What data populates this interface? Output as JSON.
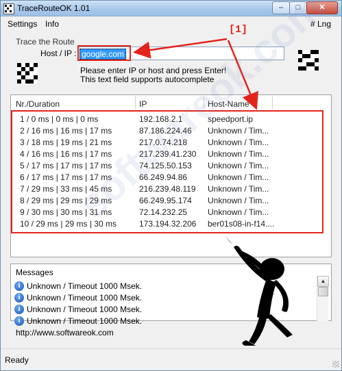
{
  "window": {
    "title": "TraceRouteOK 1.01",
    "min_glyph": "–",
    "max_glyph": "□",
    "close_glyph": "✕"
  },
  "menu": {
    "items": [
      "Settings",
      "Info"
    ],
    "lang": "# Lng"
  },
  "annotation": {
    "label": "[1]"
  },
  "trace": {
    "group_label": "Trace the Route",
    "host_label": "Host / IP :",
    "host_value": "google.com",
    "hint1": "Please enter IP or host and press Enter!",
    "hint2": "This text field supports autocomplete"
  },
  "table": {
    "columns": [
      "Nr./Duration",
      "IP",
      "Host-Name"
    ],
    "rows": [
      {
        "nr": "1 / 0 ms | 0 ms | 0 ms",
        "ip": "192.168.2.1",
        "host": "speedport.ip"
      },
      {
        "nr": "2 / 16 ms | 16 ms | 17 ms",
        "ip": "87.186.224.46",
        "host": "Unknown / Tim..."
      },
      {
        "nr": "3 / 18 ms | 19 ms | 21 ms",
        "ip": "217.0.74.218",
        "host": "Unknown / Tim..."
      },
      {
        "nr": "4 / 16 ms | 16 ms | 17 ms",
        "ip": "217.239.41.230",
        "host": "Unknown / Tim..."
      },
      {
        "nr": "5 / 17 ms | 17 ms | 17 ms",
        "ip": "74.125.50.153",
        "host": "Unknown / Tim..."
      },
      {
        "nr": "6 / 17 ms | 17 ms | 17 ms",
        "ip": "66.249.94.86",
        "host": "Unknown / Tim..."
      },
      {
        "nr": "7 / 29 ms | 33 ms | 45 ms",
        "ip": "216.239.48.119",
        "host": "Unknown / Tim..."
      },
      {
        "nr": "8 / 29 ms | 29 ms | 29 ms",
        "ip": "66.249.95.174",
        "host": "Unknown / Tim..."
      },
      {
        "nr": "9 / 30 ms | 30 ms | 31 ms",
        "ip": "72.14.232.25",
        "host": "Unknown / Tim..."
      },
      {
        "nr": "10 / 29 ms | 29 ms | 30 ms",
        "ip": "173.194.32.206",
        "host": "ber01s08-in-f14...."
      }
    ]
  },
  "messages": {
    "header": "Messages",
    "items": [
      "Unknown / Timeout 1000 Msek.",
      "Unknown / Timeout 1000 Msek.",
      "Unknown / Timeout 1000 Msek.",
      "Unknown / Timeout 1000 Msek."
    ]
  },
  "footer": {
    "url": "http://www.softwareok.com"
  },
  "status": {
    "text": "Ready"
  },
  "watermark": "softwareok.com",
  "colors": {
    "annotation_red": "#e3241b",
    "selection_blue": "#3399ff",
    "info_icon": "#1457b8"
  },
  "icons": [
    "app-icon",
    "qr-code-icon",
    "info-icon",
    "stickman-pointing-illustration"
  ]
}
